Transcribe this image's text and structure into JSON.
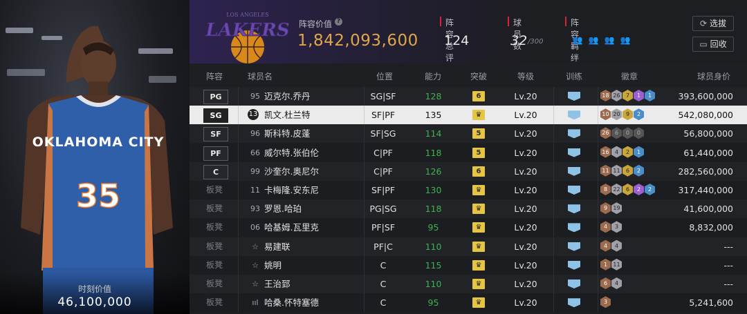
{
  "player_panel": {
    "value_label": "时刻价值",
    "value": "46,100,000",
    "jersey_team": "OKLAHOMA CITY",
    "jersey_number": "35"
  },
  "header": {
    "team_logo_text": "LAKERS",
    "team_logo_subtext": "LOS ANGELES",
    "lineup_value_label": "阵容价值",
    "lineup_value": "1,842,093,600",
    "rating_label": "阵容总评",
    "rating_value": "124",
    "count_label": "球员数",
    "count_value": "32",
    "count_max": "/300",
    "bond_label": "阵容羁绊",
    "select_button": "选拔",
    "return_button": "回收",
    "accent_color": "#d8233a",
    "value_color": "#e0a64b"
  },
  "table": {
    "columns": [
      "阵容",
      "球员名",
      "位置",
      "能力",
      "突破",
      "等级",
      "训练",
      "徽章",
      "球员身价"
    ],
    "rows": [
      {
        "slot": "PG",
        "num": "95",
        "name": "迈克尔.乔丹",
        "pos": "SG|SF",
        "ability": "128",
        "break": "6",
        "level": "Lv.20",
        "badges": [
          [
            "18",
            "bronze"
          ],
          [
            "26",
            "silver"
          ],
          [
            "7",
            "gold"
          ],
          [
            "1",
            "purple"
          ],
          [
            "1",
            "blue"
          ]
        ],
        "price": "393,600,000"
      },
      {
        "slot": "SG",
        "num": "13",
        "name": "凯文.杜兰特",
        "pos": "SF|PF",
        "ability": "135",
        "break": "crown",
        "level": "Lv.20",
        "badges": [
          [
            "10",
            "bronze"
          ],
          [
            "20",
            "silver"
          ],
          [
            "9",
            "gold"
          ],
          [
            "2",
            "blue"
          ]
        ],
        "price": "542,080,000"
      },
      {
        "slot": "SF",
        "num": "96",
        "name": "斯科特.皮蓬",
        "pos": "SF|SG",
        "ability": "114",
        "break": "5",
        "level": "Lv.20",
        "badges": [
          [
            "26",
            "bronze"
          ],
          [
            "6",
            "dark"
          ],
          [
            "0",
            "dark"
          ],
          [
            "0",
            "dark"
          ]
        ],
        "price": "56,800,000"
      },
      {
        "slot": "PF",
        "num": "66",
        "name": "威尔特.张伯伦",
        "pos": "C|PF",
        "ability": "118",
        "break": "5",
        "level": "Lv.20",
        "badges": [
          [
            "16",
            "bronze"
          ],
          [
            "4",
            "silver"
          ],
          [
            "2",
            "gold"
          ],
          [
            "1",
            "blue"
          ]
        ],
        "price": "61,440,000"
      },
      {
        "slot": "C",
        "num": "99",
        "name": "沙奎尔.奥尼尔",
        "pos": "C|PF",
        "ability": "126",
        "break": "6",
        "level": "Lv.20",
        "badges": [
          [
            "11",
            "bronze"
          ],
          [
            "11",
            "silver"
          ],
          [
            "6",
            "gold"
          ],
          [
            "2",
            "blue"
          ]
        ],
        "price": "282,560,000"
      },
      {
        "slot": "板凳",
        "num": "11",
        "name": "卡梅隆.安东尼",
        "pos": "SF|PF",
        "ability": "130",
        "break": "crown",
        "level": "Lv.20",
        "badges": [
          [
            "8",
            "bronze"
          ],
          [
            "22",
            "silver"
          ],
          [
            "6",
            "gold"
          ],
          [
            "2",
            "purple"
          ],
          [
            "2",
            "blue"
          ]
        ],
        "price": "317,440,000"
      },
      {
        "slot": "板凳",
        "num": "93",
        "name": "罗恩.哈珀",
        "pos": "PG|SG",
        "ability": "118",
        "break": "crown",
        "level": "Lv.20",
        "badges": [
          [
            "9",
            "bronze"
          ],
          [
            "19",
            "silver"
          ]
        ],
        "price": "41,600,000"
      },
      {
        "slot": "板凳",
        "num": "06",
        "name": "哈基姆.瓦里克",
        "pos": "PF|SF",
        "ability": "95",
        "break": "crown",
        "level": "Lv.20",
        "badges": [
          [
            "4",
            "bronze"
          ],
          [
            "3",
            "silver"
          ]
        ],
        "price": "8,832,000"
      },
      {
        "slot": "板凳",
        "num": "☆",
        "name": "易建联",
        "pos": "PF|C",
        "ability": "110",
        "break": "crown",
        "level": "Lv.20",
        "badges": [
          [
            "4",
            "bronze"
          ],
          [
            "4",
            "silver"
          ]
        ],
        "price": "---"
      },
      {
        "slot": "板凳",
        "num": "☆",
        "name": "姚明",
        "pos": "C",
        "ability": "115",
        "break": "crown",
        "level": "Lv.20",
        "badges": [
          [
            "1",
            "bronze"
          ],
          [
            "11",
            "silver"
          ]
        ],
        "price": "---"
      },
      {
        "slot": "板凳",
        "num": "☆",
        "name": "王治郅",
        "pos": "C",
        "ability": "110",
        "break": "crown",
        "level": "Lv.20",
        "badges": [
          [
            "6",
            "bronze"
          ],
          [
            "4",
            "silver"
          ]
        ],
        "price": "---"
      },
      {
        "slot": "板凳",
        "num": "ııl",
        "name": "哈桑.怀特塞德",
        "pos": "C",
        "ability": "95",
        "break": "crown",
        "level": "Lv.20",
        "badges": [
          [
            "3",
            "bronze"
          ]
        ],
        "price": "5,241,600"
      }
    ]
  }
}
